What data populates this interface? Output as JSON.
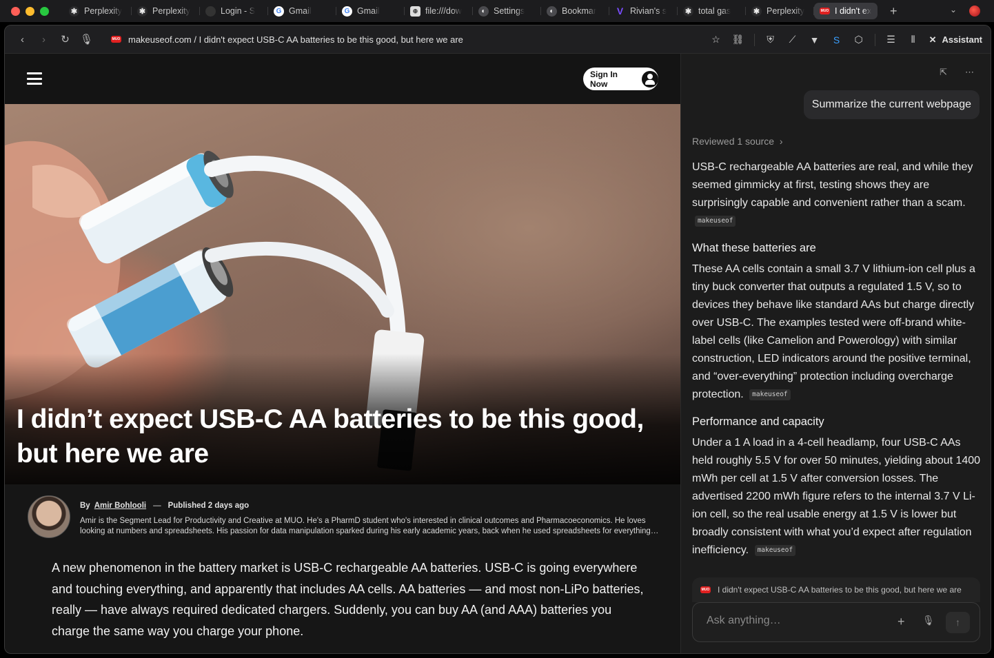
{
  "tabs": [
    {
      "label": "Perplexity",
      "icon": "perplexity-icon"
    },
    {
      "label": "Perplexity",
      "icon": "perplexity-icon"
    },
    {
      "label": "Login - S",
      "icon": "blank-icon"
    },
    {
      "label": "Gmail",
      "icon": "google-icon"
    },
    {
      "label": "Gmail",
      "icon": "google-icon"
    },
    {
      "label": "file:///dow",
      "icon": "file-icon"
    },
    {
      "label": "Settings",
      "icon": "settings-icon"
    },
    {
      "label": "Bookmar",
      "icon": "settings-icon"
    },
    {
      "label": "Rivian's s",
      "icon": "v-icon"
    },
    {
      "label": "total gas",
      "icon": "perplexity-icon"
    },
    {
      "label": "Perplexity",
      "icon": "perplexity-icon"
    },
    {
      "label": "I didn't ex",
      "icon": "muo-icon",
      "active": true
    }
  ],
  "address": {
    "url": "makeuseof.com / I didn't expect USB-C AA batteries to be this good, but here we are",
    "assistant_label": "Assistant"
  },
  "site": {
    "signin_label": "Sign In Now",
    "favicon_text": "MUO"
  },
  "article": {
    "title": "I didn’t expect USB-C AA batteries to be this good, but here we are",
    "by_prefix": "By",
    "author": "Amir Bohlooli",
    "dash": "—",
    "published": "Published 2 days ago",
    "bio": "Amir is the Segment Lead for Productivity and Creative at MUO. He's a PharmD student who's interested in clinical outcomes and Pharmacoeconomics. He loves looking at numbers and spreadsheets. His passion for data manipulation sparked during his early academic years, back when he used spreadsheets for everything from tracking grades to planning budgets.",
    "body": "A new phenomenon in the battery market is USB-C rechargeable AA batteries. USB-C is going everywhere and touching everything, and apparently that includes AA cells. AA batteries — and most non-LiPo batteries, really — have always required dedicated chargers. Suddenly, you can buy AA (and AAA) batteries you charge the same way you charge your phone."
  },
  "assistant": {
    "user_message": "Summarize the current webpage",
    "reviewed": "Reviewed 1 source",
    "intro": "USB-C rechargeable AA batteries are real, and while they seemed gimmicky at first, testing shows they are surprisingly capable and convenient rather than a scam.",
    "cite": "makeuseof",
    "h1": "What these batteries are",
    "p1": "These AA cells contain a small 3.7 V lithium-ion cell plus a tiny buck converter that outputs a regulated 1.5 V, so to devices they behave like standard AAs but charge directly over USB-C. The examples tested were off-brand white-label cells (like Camelion and Powerology) with similar construction, LED indicators around the positive terminal, and “over-everything” protection including overcharge protection.",
    "h2": "Performance and capacity",
    "p2": "Under a 1 A load in a 4-cell headlamp, four USB-C AAs held roughly 5.5 V for over 50 minutes, yielding about 1400 mWh per cell at 1.5 V after conversion losses. The advertised 2200 mWh figure refers to the internal 3.7 V Li-ion cell, so the real usable energy at 1.5 V is lower but broadly consistent with what you’d expect after regulation inefficiency.",
    "context_chip": "I didn't expect USB-C AA batteries to be this good, but here we are",
    "input_placeholder": "Ask anything…"
  }
}
